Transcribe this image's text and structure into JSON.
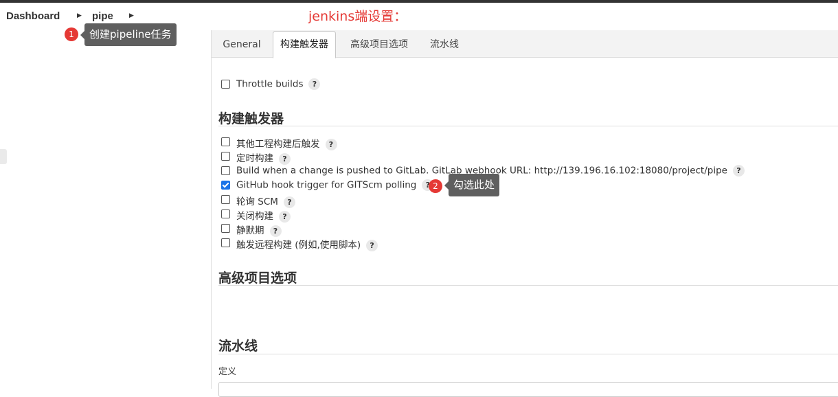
{
  "breadcrumb": {
    "items": [
      "Dashboard",
      "pipe"
    ]
  },
  "annotations": {
    "title": "jenkins端设置：",
    "step1_number": "1",
    "step1_text": "创建pipeline任务",
    "step2_number": "2",
    "step2_text": "勾选此处"
  },
  "tabs": [
    "General",
    "构建触发器",
    "高级项目选项",
    "流水线"
  ],
  "active_tab": "构建触发器",
  "throttle": {
    "label": "Throttle builds",
    "help": "?"
  },
  "sections": {
    "triggers": "构建触发器",
    "advanced": "高级项目选项",
    "pipeline": "流水线"
  },
  "triggers": [
    {
      "label": "其他工程构建后触发",
      "checked": false,
      "help": "?"
    },
    {
      "label": "定时构建",
      "checked": false,
      "help": "?"
    },
    {
      "label": "Build when a change is pushed to GitLab. GitLab webhook URL: http://139.196.16.102:18080/project/pipe",
      "checked": false,
      "help": "?"
    },
    {
      "label": "GitHub hook trigger for GITScm polling",
      "checked": true,
      "help": "?"
    },
    {
      "label": "轮询 SCM",
      "checked": false,
      "help": "?"
    },
    {
      "label": "关闭构建",
      "checked": false,
      "help": "?"
    },
    {
      "label": "静默期",
      "checked": false,
      "help": "?"
    },
    {
      "label": "触发远程构建 (例如,使用脚本)",
      "checked": false,
      "help": "?"
    }
  ],
  "pipeline": {
    "definition_label": "定义"
  },
  "colors": {
    "annotation_red": "#e53935",
    "tooltip_bg": "#5f5f5f",
    "checkbox_checked": "#1a73e8"
  }
}
